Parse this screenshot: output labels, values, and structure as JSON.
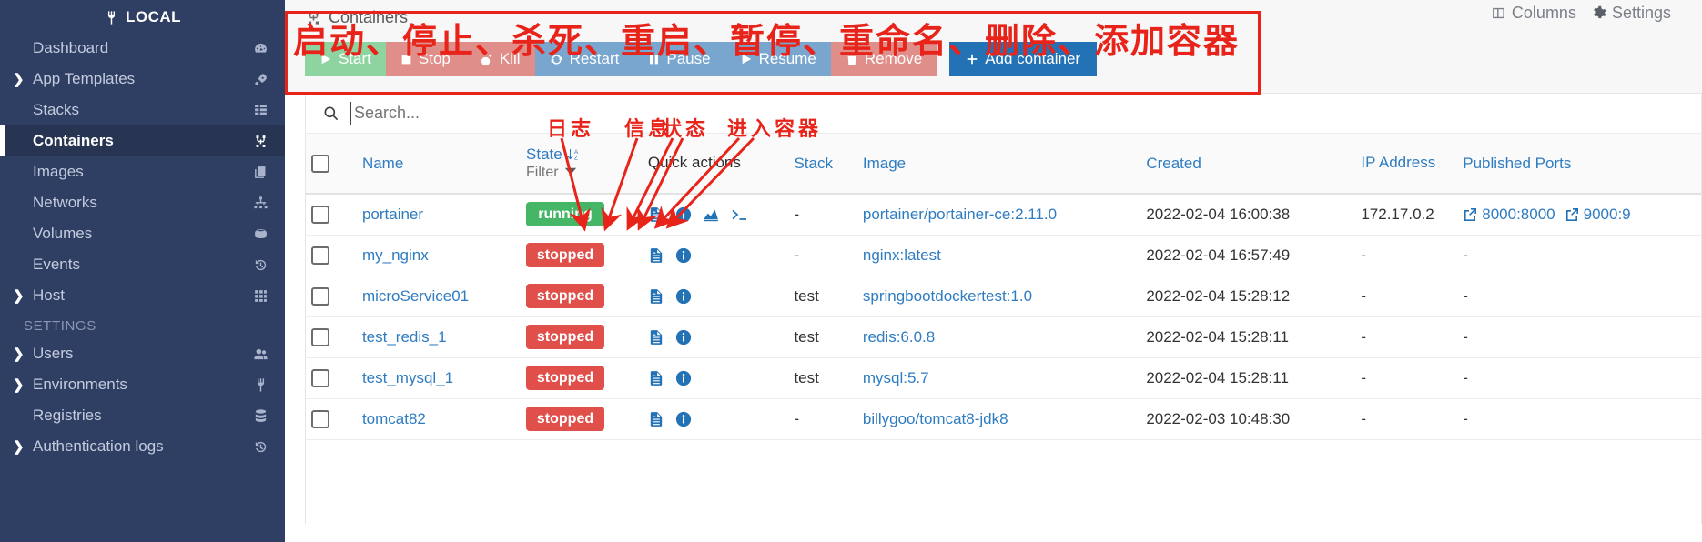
{
  "sidebar": {
    "environment": {
      "label": "LOCAL",
      "icon": "plug-icon"
    },
    "items": [
      {
        "label": "Dashboard",
        "icon": "dashboard-icon",
        "expandable": false,
        "active": false
      },
      {
        "label": "App Templates",
        "icon": "rocket-icon",
        "expandable": true,
        "active": false
      },
      {
        "label": "Stacks",
        "icon": "stacks-icon",
        "expandable": false,
        "active": false
      },
      {
        "label": "Containers",
        "icon": "containers-icon",
        "expandable": false,
        "active": true
      },
      {
        "label": "Images",
        "icon": "images-icon",
        "expandable": false,
        "active": false
      },
      {
        "label": "Networks",
        "icon": "network-icon",
        "expandable": false,
        "active": false
      },
      {
        "label": "Volumes",
        "icon": "volumes-icon",
        "expandable": false,
        "active": false
      },
      {
        "label": "Events",
        "icon": "history-icon",
        "expandable": false,
        "active": false
      },
      {
        "label": "Host",
        "icon": "host-icon",
        "expandable": true,
        "active": false
      }
    ],
    "section_label": "SETTINGS",
    "settings_items": [
      {
        "label": "Users",
        "icon": "users-icon",
        "expandable": true,
        "active": false
      },
      {
        "label": "Environments",
        "icon": "plug-icon",
        "expandable": true,
        "active": false
      },
      {
        "label": "Registries",
        "icon": "database-icon",
        "expandable": false,
        "active": false
      },
      {
        "label": "Authentication logs",
        "icon": "history-icon",
        "expandable": true,
        "active": false
      }
    ]
  },
  "header": {
    "title": "Containers",
    "title_icon": "containers-icon",
    "columns_label": "Columns",
    "columns_icon": "columns-icon",
    "settings_label": "Settings",
    "settings_icon": "gear-icon"
  },
  "toolbar": {
    "buttons": [
      {
        "label": "Start",
        "icon": "play-icon",
        "color": "#8ed4a0"
      },
      {
        "label": "Stop",
        "icon": "stop-icon",
        "color": "#e08e89"
      },
      {
        "label": "Kill",
        "icon": "bomb-icon",
        "color": "#e08e89"
      },
      {
        "label": "Restart",
        "icon": "restart-icon",
        "color": "#78a6cf"
      },
      {
        "label": "Pause",
        "icon": "pause-icon",
        "color": "#78a6cf"
      },
      {
        "label": "Resume",
        "icon": "play-icon",
        "color": "#78a6cf"
      },
      {
        "label": "Remove",
        "icon": "trash-icon",
        "color": "#e08e89"
      },
      {
        "label": "Add container",
        "icon": "plus-icon",
        "color": "#2372b5"
      }
    ]
  },
  "search": {
    "placeholder": "Search...",
    "value": "",
    "icon": "search-icon"
  },
  "table": {
    "headers": {
      "name": "Name",
      "state": "State",
      "state_sort_icon": "sort-az-icon",
      "filter": "Filter",
      "filter_icon": "funnel-icon",
      "quick_actions": "Quick actions",
      "stack": "Stack",
      "image": "Image",
      "created": "Created",
      "ip_address": "IP Address",
      "published_ports": "Published Ports"
    },
    "rows": [
      {
        "name": "portainer",
        "state": "running",
        "quick_actions": [
          "logs-icon",
          "info-icon",
          "stats-icon",
          "console-icon"
        ],
        "stack": "-",
        "image": "portainer/portainer-ce:2.11.0",
        "created": "2022-02-04 16:00:38",
        "ip_address": "172.17.0.2",
        "ports": [
          "8000:8000",
          "9000:9"
        ]
      },
      {
        "name": "my_nginx",
        "state": "stopped",
        "quick_actions": [
          "logs-icon",
          "info-icon"
        ],
        "stack": "-",
        "image": "nginx:latest",
        "created": "2022-02-04 16:57:49",
        "ip_address": "-",
        "ports": [
          "-"
        ]
      },
      {
        "name": "microService01",
        "state": "stopped",
        "quick_actions": [
          "logs-icon",
          "info-icon"
        ],
        "stack": "test",
        "image": "springbootdockertest:1.0",
        "created": "2022-02-04 15:28:12",
        "ip_address": "-",
        "ports": [
          "-"
        ]
      },
      {
        "name": "test_redis_1",
        "state": "stopped",
        "quick_actions": [
          "logs-icon",
          "info-icon"
        ],
        "stack": "test",
        "image": "redis:6.0.8",
        "created": "2022-02-04 15:28:11",
        "ip_address": "-",
        "ports": [
          "-"
        ]
      },
      {
        "name": "test_mysql_1",
        "state": "stopped",
        "quick_actions": [
          "logs-icon",
          "info-icon"
        ],
        "stack": "test",
        "image": "mysql:5.7",
        "created": "2022-02-04 15:28:11",
        "ip_address": "-",
        "ports": [
          "-"
        ]
      },
      {
        "name": "tomcat82",
        "state": "stopped",
        "quick_actions": [
          "logs-icon",
          "info-icon"
        ],
        "stack": "-",
        "image": "billygoo/tomcat8-jdk8",
        "created": "2022-02-03 10:48:30",
        "ip_address": "-",
        "ports": [
          "-"
        ]
      }
    ]
  },
  "annotations": {
    "color": "#e8241a",
    "toolbar_note": "启动、停止、杀死、重启、暂停、重命名、删除、添加容器",
    "logs": "日志",
    "info": "信息",
    "stats": "状态",
    "exec": "进入容器"
  },
  "colors": {
    "sidebar_bg": "#2f3e63",
    "accent_blue": "#2372b5",
    "link_blue": "#2f7cc1",
    "running_green": "#45b566",
    "stopped_red": "#e04f4a",
    "annotation_red": "#e8241a"
  }
}
